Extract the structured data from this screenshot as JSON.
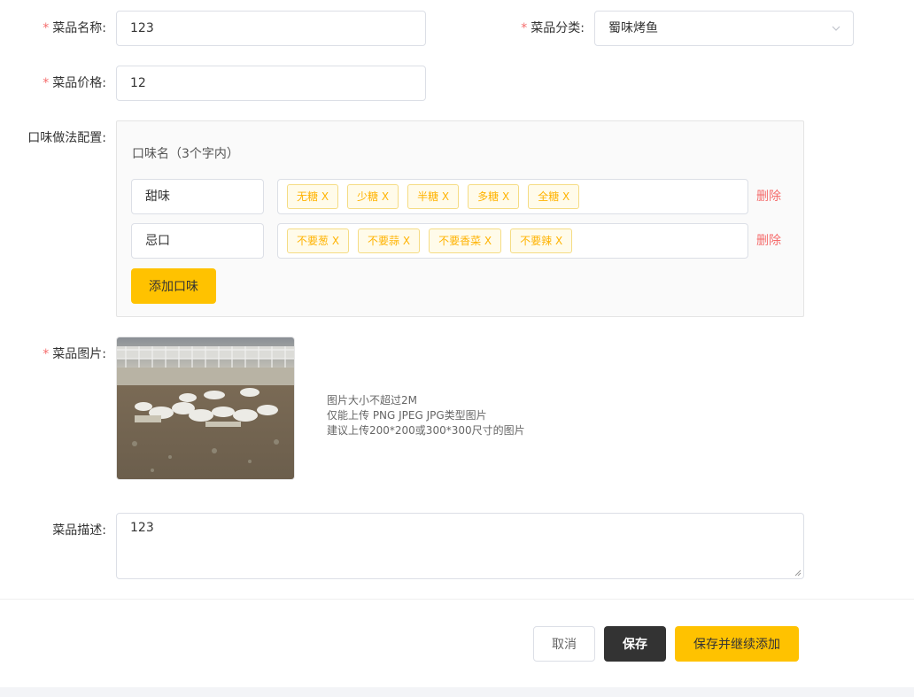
{
  "form": {
    "name": {
      "label": "菜品名称:",
      "value": "123",
      "required": true
    },
    "category": {
      "label": "菜品分类:",
      "value": "蜀味烤鱼",
      "required": true
    },
    "price": {
      "label": "菜品价格:",
      "value": "12",
      "required": true
    },
    "flavor": {
      "label": "口味做法配置:",
      "caption": "口味名（3个字内）",
      "rows": [
        {
          "name": "甜味",
          "tags": [
            "无糖 X",
            "少糖 X",
            "半糖 X",
            "多糖 X",
            "全糖 X"
          ],
          "delete_label": "删除"
        },
        {
          "name": "忌口",
          "tags": [
            "不要葱 X",
            "不要蒜 X",
            "不要香菜 X",
            "不要辣 X"
          ],
          "delete_label": "删除"
        }
      ],
      "add_label": "添加口味"
    },
    "image": {
      "label": "菜品图片:",
      "required": true,
      "hints": [
        "图片大小不超过2M",
        "仅能上传 PNG JPEG JPG类型图片",
        "建议上传200*200或300*300尺寸的图片"
      ]
    },
    "description": {
      "label": "菜品描述:",
      "value": "123"
    }
  },
  "actions": {
    "cancel": "取消",
    "save": "保存",
    "save_continue": "保存并继续添加"
  },
  "colors": {
    "accent": "#ffc200",
    "required": "#f56c6c",
    "dark": "#333333"
  }
}
